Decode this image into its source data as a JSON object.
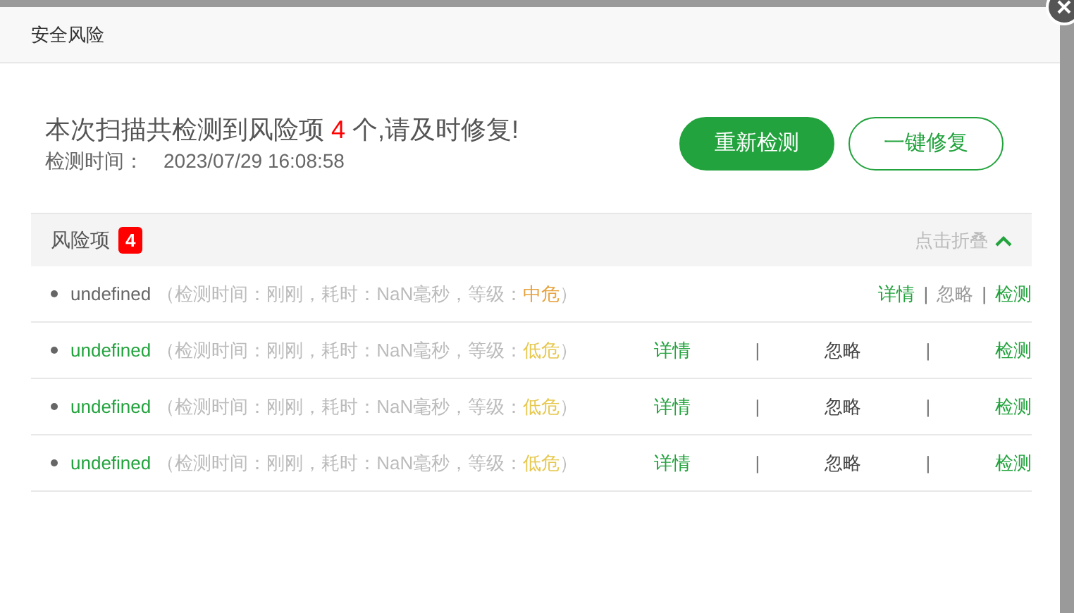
{
  "dialog": {
    "title": "安全风险"
  },
  "summary": {
    "prefix": "本次扫描共检测到风险项",
    "count": "4",
    "suffix": "个,请及时修复!",
    "time_label": "检测时间：",
    "time_value": "2023/07/29 16:08:58"
  },
  "buttons": [
    {
      "label": "重新检测",
      "kind": "primary"
    },
    {
      "label": "一键修复",
      "kind": "outline"
    }
  ],
  "section": {
    "title": "风险项",
    "badge": "4",
    "toggle": "点击折叠",
    "expanded": true
  },
  "risks": [
    {
      "kind": "compact",
      "name": "undefined",
      "detail": "（检测时间：刚刚，耗时：NaN毫秒，等级：",
      "level": "中危",
      "color": "#e6a23c",
      "close": "）",
      "actions": [
        "详情",
        "忽略",
        "检测"
      ],
      "separators": [
        "|",
        "|"
      ]
    },
    {
      "kind": "spread",
      "name": "undefined",
      "detail": "（检测时间：刚刚，耗时：NaN毫秒，等级：",
      "level": "低危",
      "color": "#e6c84e",
      "close": "）",
      "actions": [
        "详情",
        "忽略",
        "检测"
      ],
      "separators": [
        "|",
        "|"
      ]
    },
    {
      "kind": "spread",
      "name": "undefined",
      "detail": "（检测时间：刚刚，耗时：NaN毫秒，等级：",
      "level": "低危",
      "color": "#e6c84e",
      "close": "）",
      "actions": [
        "详情",
        "忽略",
        "检测"
      ],
      "separators": [
        "|",
        "|"
      ]
    },
    {
      "kind": "spread",
      "name": "undefined",
      "detail": "（检测时间：刚刚，耗时：NaN毫秒，等级：",
      "level": "低危",
      "color": "#e6c84e",
      "close": "）",
      "actions": [
        "详情",
        "忽略",
        "检测"
      ],
      "separators": [
        "|",
        "|"
      ]
    }
  ]
}
